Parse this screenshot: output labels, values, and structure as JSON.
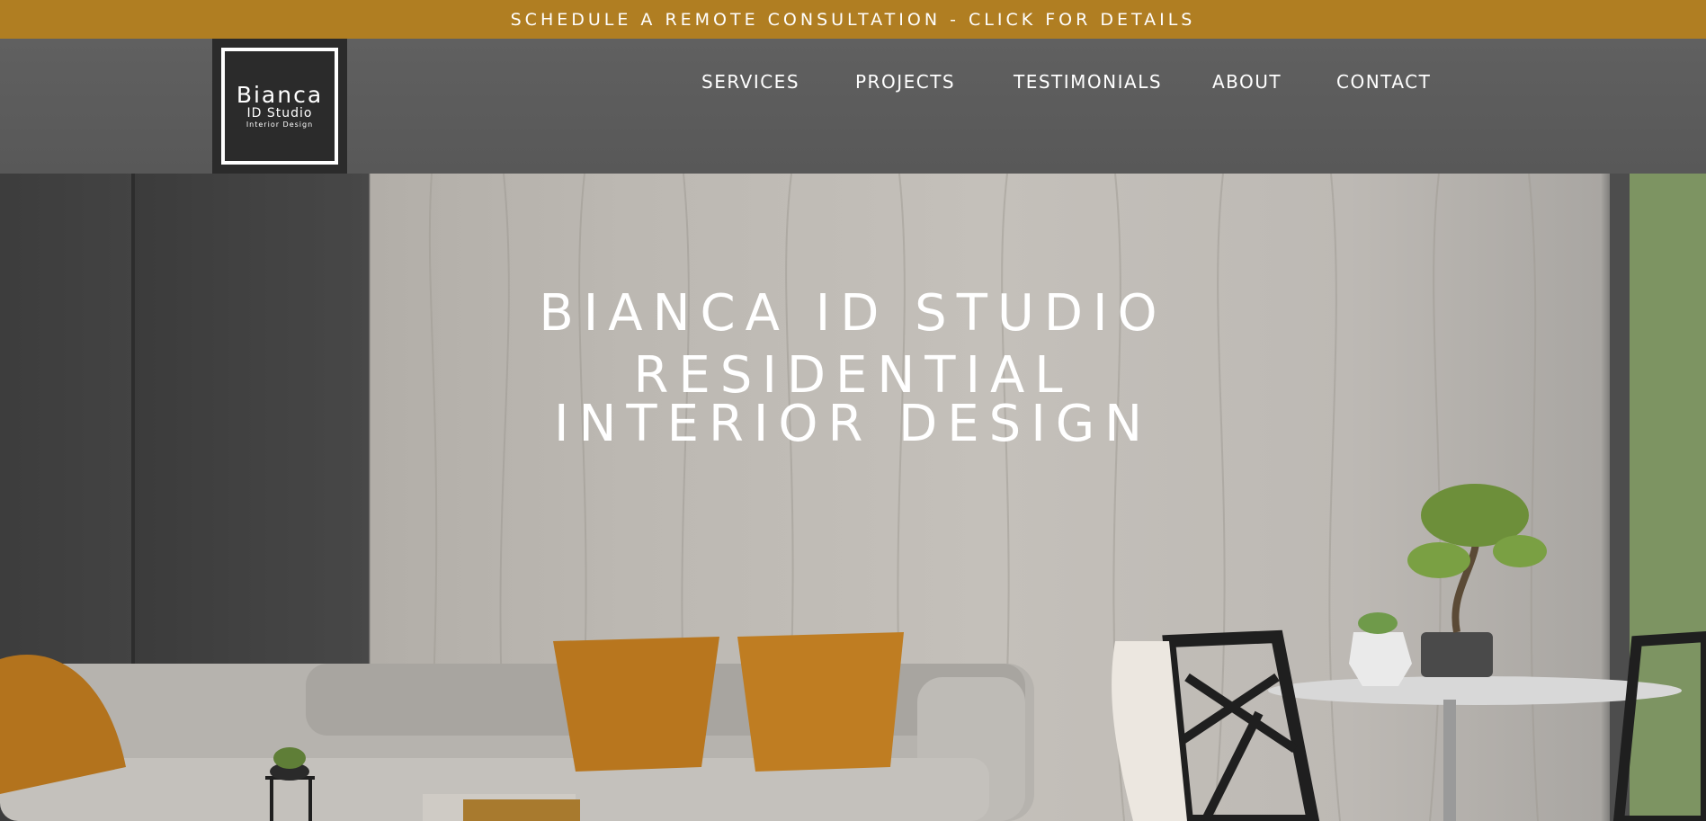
{
  "announcement": {
    "text": "SCHEDULE A REMOTE CONSULTATION - CLICK FOR DETAILS",
    "background": "#b07e22"
  },
  "logo": {
    "name": "Bianca",
    "subtitle": "ID Studio",
    "tagline": "Interior Design"
  },
  "nav": {
    "items": [
      "SERVICES",
      "PROJECTS",
      "TESTIMONIALS",
      "ABOUT",
      "CONTACT"
    ]
  },
  "hero": {
    "title": "BIANCA ID STUDIO",
    "subtitle_line1": "RESIDENTIAL",
    "subtitle_line2": "INTERIOR DESIGN"
  }
}
